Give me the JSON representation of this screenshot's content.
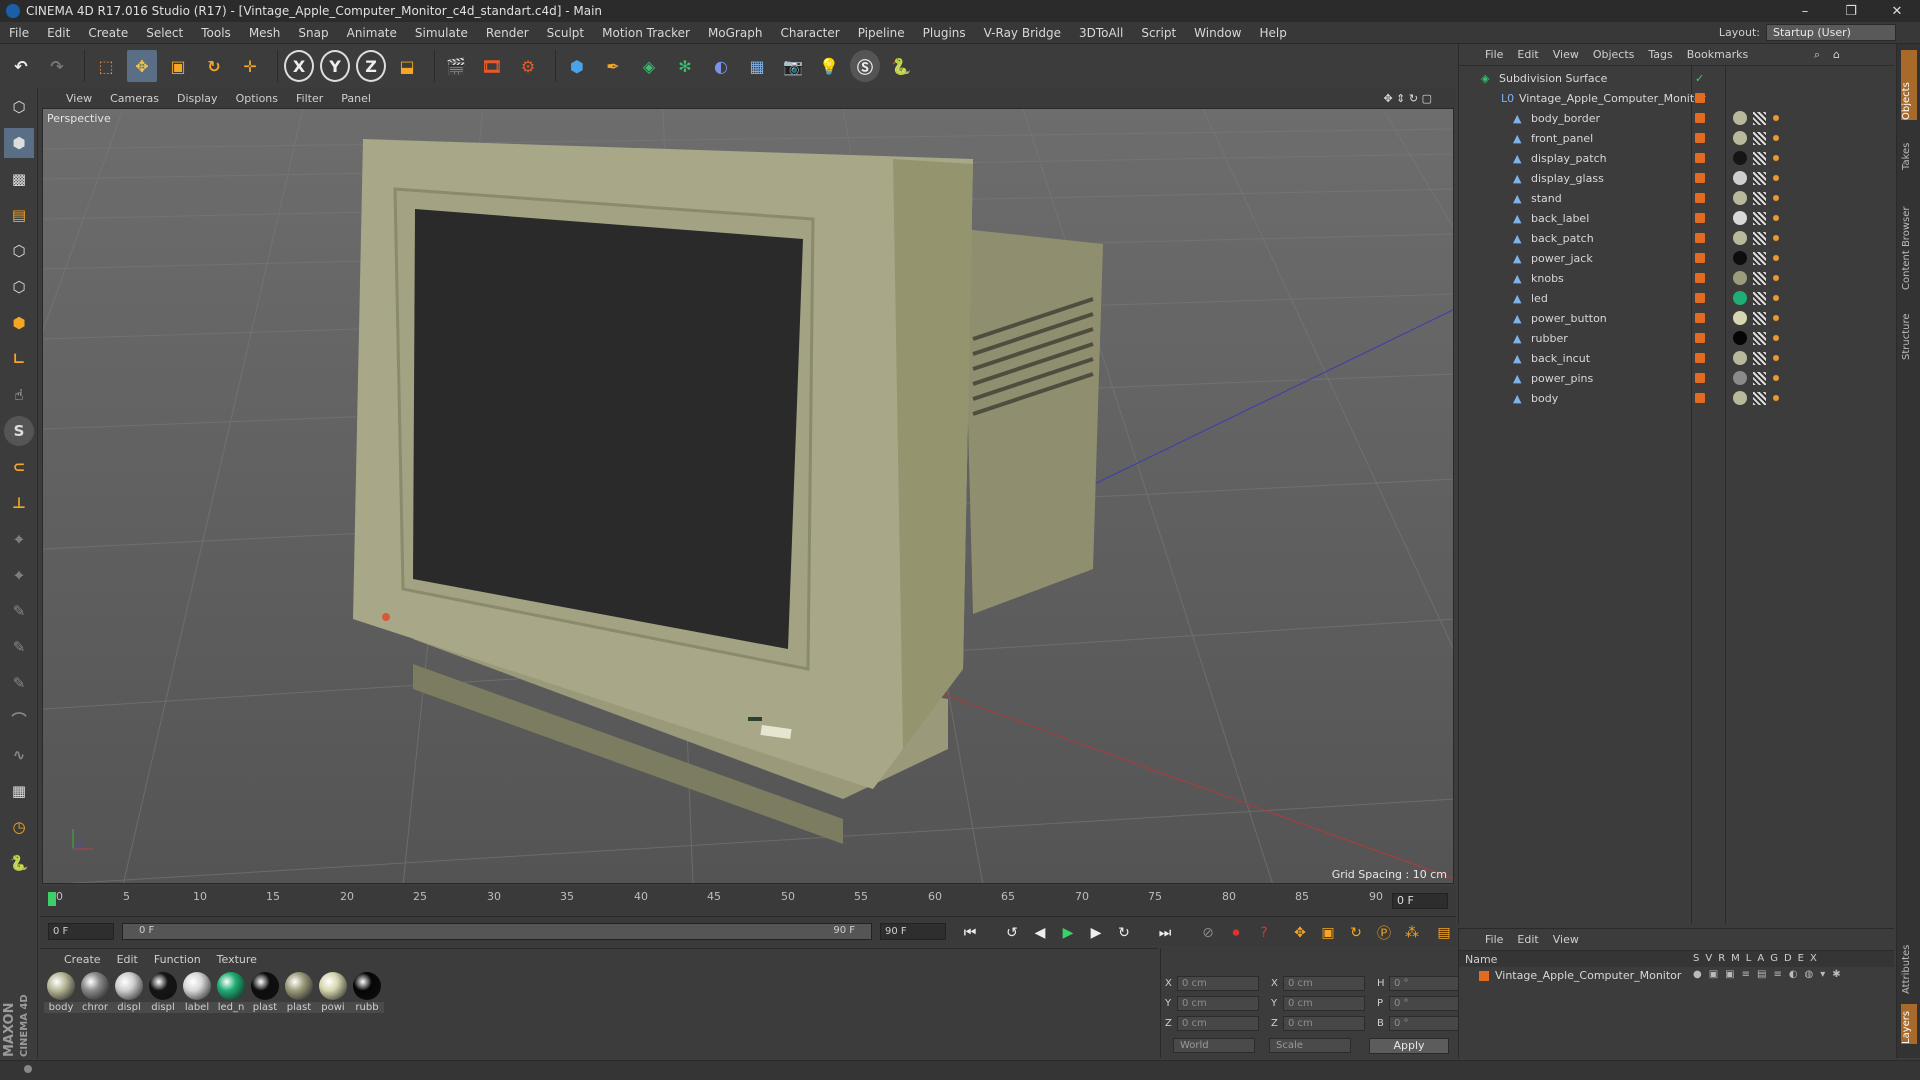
{
  "title": "CINEMA 4D R17.016 Studio (R17) - [Vintage_Apple_Computer_Monitor_c4d_standart.c4d] - Main",
  "window_controls": {
    "minimize": "–",
    "maximize": "❐",
    "close": "✕"
  },
  "menu": [
    "File",
    "Edit",
    "Create",
    "Select",
    "Tools",
    "Mesh",
    "Snap",
    "Animate",
    "Simulate",
    "Render",
    "Sculpt",
    "Motion Tracker",
    "MoGraph",
    "Character",
    "Pipeline",
    "Plugins",
    "V-Ray Bridge",
    "3DToAll",
    "Script",
    "Window",
    "Help"
  ],
  "layout": {
    "label": "Layout:",
    "value": "Startup (User)"
  },
  "toolbar": {
    "x": "X",
    "y": "Y",
    "z": "Z"
  },
  "viewport_menu": [
    "View",
    "Cameras",
    "Display",
    "Options",
    "Filter",
    "Panel"
  ],
  "viewport": {
    "label": "Perspective",
    "grid_spacing": "Grid Spacing : 10 cm"
  },
  "timeline": {
    "ticks": [
      "0",
      "5",
      "10",
      "15",
      "20",
      "25",
      "30",
      "35",
      "40",
      "45",
      "50",
      "55",
      "60",
      "65",
      "70",
      "75",
      "80",
      "85",
      "90"
    ],
    "current_frame": "0 F"
  },
  "playbar": {
    "start": "0 F",
    "slider_start": "0 F",
    "slider_end": "90 F",
    "end": "90 F"
  },
  "material_menu": [
    "Create",
    "Edit",
    "Function",
    "Texture"
  ],
  "materials": [
    {
      "label": "body",
      "color": "#b8b89a"
    },
    {
      "label": "chror",
      "color": "#8a8a8a"
    },
    {
      "label": "displ",
      "color": "#cfcfcf"
    },
    {
      "label": "displ",
      "color": "#151515"
    },
    {
      "label": "label",
      "color": "#d8d8d8"
    },
    {
      "label": "led_n",
      "color": "#1fae73"
    },
    {
      "label": "plast",
      "color": "#0d0d0d"
    },
    {
      "label": "plast",
      "color": "#9c9c7c"
    },
    {
      "label": "powi",
      "color": "#d6d6b0"
    },
    {
      "label": "rubb",
      "color": "#050505"
    }
  ],
  "coords": {
    "rows": [
      {
        "a1": "X",
        "v1": "0 cm",
        "a2": "X",
        "v2": "0 cm",
        "a3": "H",
        "v3": "0 °"
      },
      {
        "a1": "Y",
        "v1": "0 cm",
        "a2": "Y",
        "v2": "0 cm",
        "a3": "P",
        "v3": "0 °"
      },
      {
        "a1": "Z",
        "v1": "0 cm",
        "a2": "Z",
        "v2": "0 cm",
        "a3": "B",
        "v3": "0 °"
      }
    ],
    "mode1": "World",
    "mode2": "Scale",
    "apply": "Apply"
  },
  "objects_menu": [
    "File",
    "Edit",
    "View",
    "Objects",
    "Tags",
    "Bookmarks"
  ],
  "objects": [
    {
      "name": "Subdivision Surface"
    },
    {
      "name": "Vintage_Apple_Computer_Monitor"
    },
    {
      "name": "body_border",
      "mat": "#b8b89a"
    },
    {
      "name": "front_panel",
      "mat": "#b8b89a"
    },
    {
      "name": "display_patch",
      "mat": "#151515"
    },
    {
      "name": "display_glass",
      "mat": "#cfcfcf"
    },
    {
      "name": "stand",
      "mat": "#b8b89a"
    },
    {
      "name": "back_label",
      "mat": "#d8d8d8"
    },
    {
      "name": "back_patch",
      "mat": "#b8b89a"
    },
    {
      "name": "power_jack",
      "mat": "#0d0d0d"
    },
    {
      "name": "knobs",
      "mat": "#9c9c7c"
    },
    {
      "name": "led",
      "mat": "#1fae73"
    },
    {
      "name": "power_button",
      "mat": "#d6d6b0"
    },
    {
      "name": "rubber",
      "mat": "#050505"
    },
    {
      "name": "back_incut",
      "mat": "#b8b89a"
    },
    {
      "name": "power_pins",
      "mat": "#8a8a8a"
    },
    {
      "name": "body",
      "mat": "#b8b89a"
    }
  ],
  "layers_menu": [
    "File",
    "Edit",
    "View"
  ],
  "layers": {
    "header": "Name",
    "cols": [
      "S",
      "V",
      "R",
      "M",
      "L",
      "A",
      "G",
      "D",
      "E",
      "X"
    ],
    "item": "Vintage_Apple_Computer_Monitor"
  },
  "side_tabs": [
    "Objects",
    "Takes",
    "Content Browser",
    "Structure",
    "Attributes",
    "Layers"
  ],
  "logo": {
    "brand": "MAXON",
    "product": "CINEMA 4D"
  }
}
